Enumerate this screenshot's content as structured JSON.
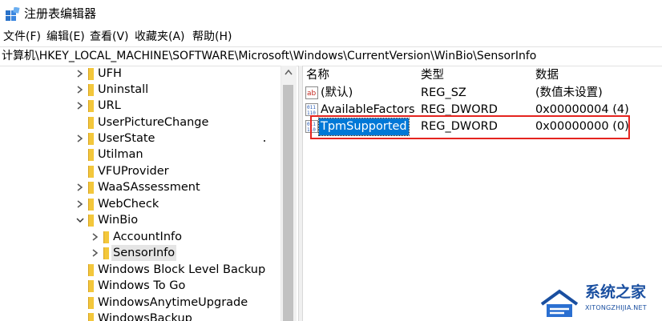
{
  "window": {
    "title": "注册表编辑器"
  },
  "menu": {
    "items": [
      {
        "label": "文件(F)"
      },
      {
        "label": "编辑(E)"
      },
      {
        "label": "查看(V)"
      },
      {
        "label": "收藏夹(A)"
      },
      {
        "label": "帮助(H)"
      }
    ]
  },
  "address": {
    "path": "计算机\\HKEY_LOCAL_MACHINE\\SOFTWARE\\Microsoft\\Windows\\CurrentVersion\\WinBio\\SensorInfo"
  },
  "tree": {
    "items": [
      {
        "label": "UFH",
        "expander": "collapsed"
      },
      {
        "label": "Uninstall",
        "expander": "collapsed"
      },
      {
        "label": "URL",
        "expander": "collapsed"
      },
      {
        "label": "UserPictureChange",
        "expander": "none"
      },
      {
        "label": "UserState",
        "expander": "collapsed"
      },
      {
        "label": "Utilman",
        "expander": "none"
      },
      {
        "label": "VFUProvider",
        "expander": "none"
      },
      {
        "label": "WaaSAssessment",
        "expander": "collapsed"
      },
      {
        "label": "WebCheck",
        "expander": "collapsed"
      },
      {
        "label": "WinBio",
        "expander": "expanded"
      },
      {
        "label": "AccountInfo",
        "expander": "collapsed"
      },
      {
        "label": "SensorInfo",
        "expander": "collapsed",
        "selected": true
      },
      {
        "label": "Windows Block Level Backup",
        "expander": "none"
      },
      {
        "label": "Windows To Go",
        "expander": "none"
      },
      {
        "label": "WindowsAnytimeUpgrade",
        "expander": "none"
      },
      {
        "label": "WindowsBackup",
        "expander": "none"
      }
    ]
  },
  "list": {
    "columns": {
      "name": "名称",
      "type": "类型",
      "data": "数据"
    },
    "rows": [
      {
        "name": "(默认)",
        "type": "REG_SZ",
        "data": "(数值未设置)",
        "icon": "string-value-icon"
      },
      {
        "name": "AvailableFactors",
        "type": "REG_DWORD",
        "data": "0x00000004 (4)",
        "icon": "binary-value-icon"
      },
      {
        "name": "TpmSupported",
        "type": "REG_DWORD",
        "data": "0x00000000 (0)",
        "icon": "binary-value-icon",
        "selected": true
      }
    ]
  },
  "watermark": {
    "title": "系统之家",
    "url": "XITONGZHIJIA.NET"
  },
  "colors": {
    "selection": "#0078d7",
    "highlight_border": "#e5241f",
    "folder": "#f3c73b",
    "watermark": "#1a4fa0"
  }
}
